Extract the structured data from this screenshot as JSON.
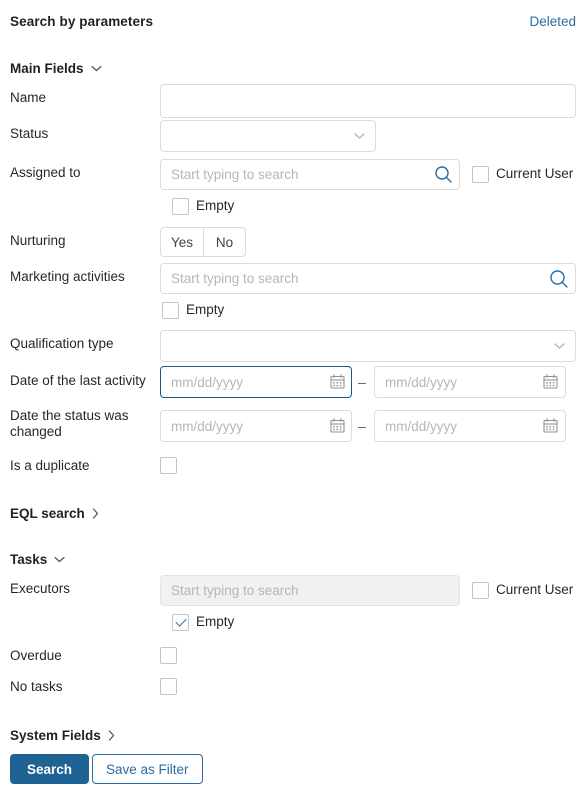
{
  "header": {
    "title": "Search by parameters",
    "deleted_link": "Deleted"
  },
  "sections": {
    "main_fields": {
      "label": "Main Fields",
      "state": "expanded"
    },
    "eql_search": {
      "label": "EQL search",
      "state": "collapsed"
    },
    "tasks": {
      "label": "Tasks",
      "state": "expanded"
    },
    "system_fields": {
      "label": "System Fields",
      "state": "collapsed"
    }
  },
  "main_fields": {
    "name": {
      "label": "Name",
      "value": "",
      "placeholder": ""
    },
    "status": {
      "label": "Status",
      "value": ""
    },
    "assigned_to": {
      "label": "Assigned to",
      "value": "",
      "placeholder": "Start typing to search",
      "current_user_label": "Current User",
      "current_user_checked": false,
      "empty_label": "Empty",
      "empty_checked": false
    },
    "nurturing": {
      "label": "Nurturing",
      "yes": "Yes",
      "no": "No",
      "selected": ""
    },
    "marketing_activities": {
      "label": "Marketing activities",
      "value": "",
      "placeholder": "Start typing to search",
      "empty_label": "Empty",
      "empty_checked": false
    },
    "qualification_type": {
      "label": "Qualification type",
      "value": ""
    },
    "date_last_activity": {
      "label": "Date of the last activity",
      "from_value": "",
      "from_placeholder": "mm/dd/yyyy",
      "to_value": "",
      "to_placeholder": "mm/dd/yyyy",
      "separator": "–",
      "focused": "from"
    },
    "date_status_changed": {
      "label": "Date the status was changed",
      "from_value": "",
      "from_placeholder": "mm/dd/yyyy",
      "to_value": "",
      "to_placeholder": "mm/dd/yyyy",
      "separator": "–",
      "focused": ""
    },
    "is_a_duplicate": {
      "label": "Is a duplicate",
      "checked": false
    }
  },
  "tasks": {
    "executors": {
      "label": "Executors",
      "value": "",
      "placeholder": "Start typing to search",
      "disabled": true,
      "current_user_label": "Current User",
      "current_user_checked": false,
      "empty_label": "Empty",
      "empty_checked": true
    },
    "overdue": {
      "label": "Overdue",
      "checked": false
    },
    "no_tasks": {
      "label": "No tasks",
      "checked": false
    }
  },
  "footer": {
    "search_button": "Search",
    "save_filter_button": "Save as Filter"
  },
  "colors": {
    "accent_blue": "#2a6ca3",
    "primary_button": "#1f6394",
    "focus_border": "#1b5a86",
    "border": "#dcdcdc",
    "placeholder": "#b6b6b6",
    "disabled_bg": "#f1f1f1",
    "text": "#22292e"
  },
  "icons": {
    "search": "search-icon",
    "calendar": "calendar-icon",
    "chevron_down": "chevron-down-icon",
    "chevron_right": "chevron-right-icon"
  }
}
